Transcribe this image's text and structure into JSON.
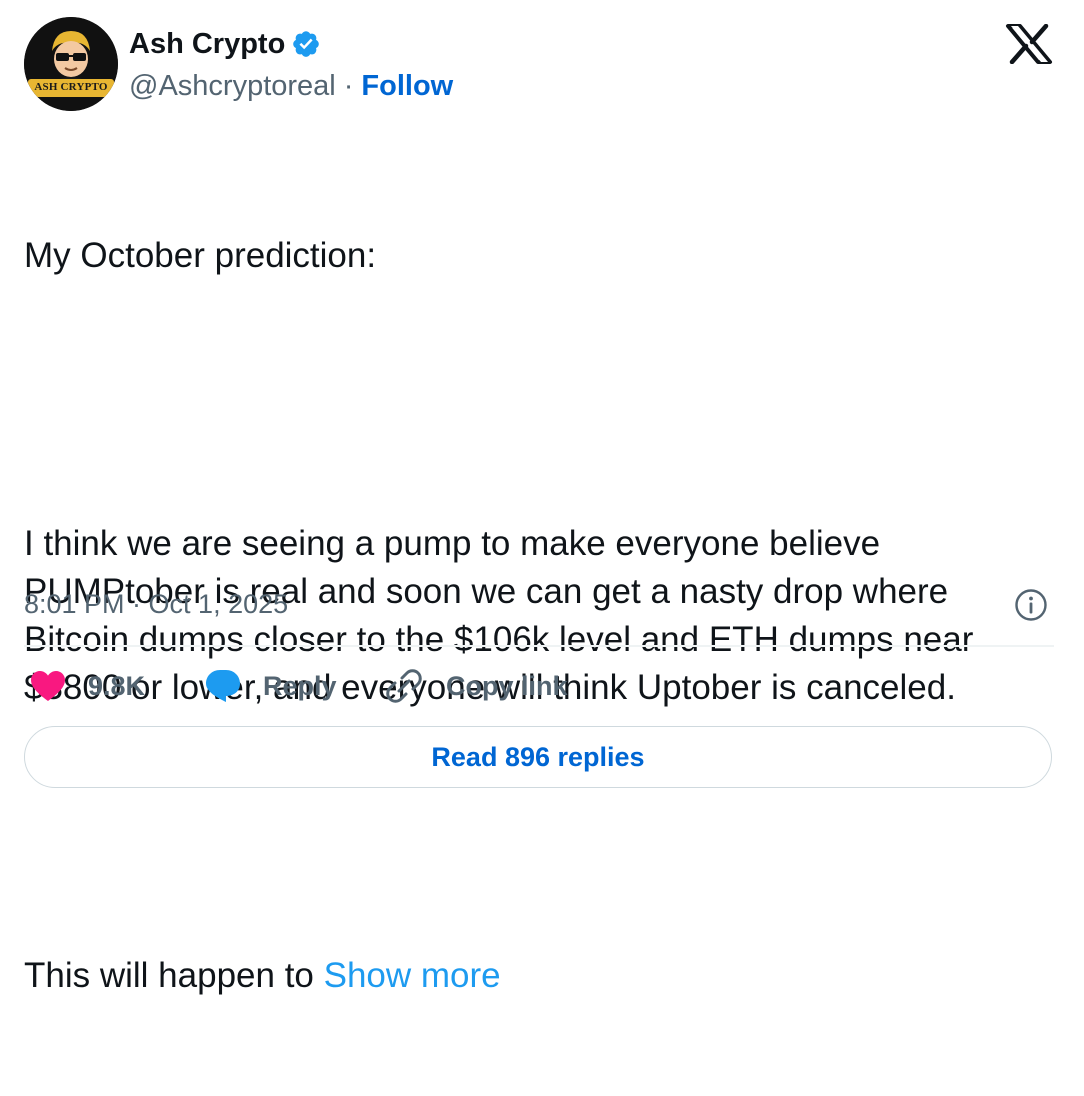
{
  "author": {
    "display_name": "Ash Crypto",
    "handle": "@Ashcryptoreal",
    "separator": "·",
    "follow_label": "Follow",
    "verified": true,
    "avatar_text": "ASH CRYPTO"
  },
  "tweet": {
    "paragraphs": [
      "My October prediction:",
      "I think we are seeing a pump to make everyone believe PUMPtober is real and soon we can get a nasty drop where Bitcoin dumps closer to the $106k level and ETH dumps near $3800 or lower, and everyone will think Uptober is canceled.",
      "This will happen to "
    ],
    "show_more_label": "Show more",
    "timestamp": "8:01 PM · Oct 1, 2025"
  },
  "actions": {
    "like_count": "9.8K",
    "reply_label": "Reply",
    "copy_link_label": "Copy link"
  },
  "read_replies_label": "Read 896 replies",
  "colors": {
    "link_blue": "#1d9bf0",
    "follow_blue": "#0066d3",
    "like_pink": "#f91880",
    "muted_gray": "#536471",
    "text": "#0f1419"
  },
  "icons": {
    "verified": "verified-badge-icon",
    "brand": "x-logo-icon",
    "info": "info-icon",
    "like": "heart-icon",
    "reply": "speech-bubble-icon",
    "copy": "link-icon"
  }
}
